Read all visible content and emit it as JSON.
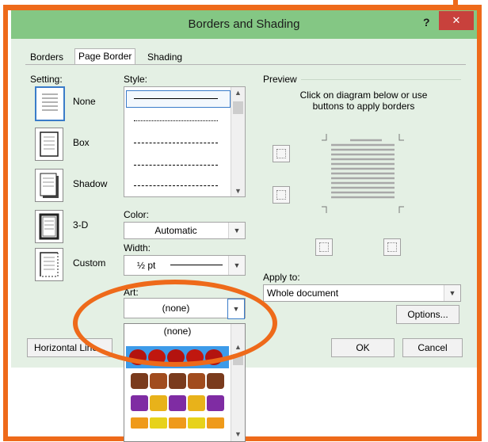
{
  "dialog": {
    "title": "Borders and Shading",
    "help": "?",
    "close": "✕",
    "tabs": [
      {
        "label": "Borders"
      },
      {
        "label": "Page Border"
      },
      {
        "label": "Shading"
      }
    ]
  },
  "setting": {
    "label": "Setting:",
    "items": [
      {
        "label": "None"
      },
      {
        "label": "Box"
      },
      {
        "label": "Shadow"
      },
      {
        "label": "3-D"
      },
      {
        "label": "Custom"
      }
    ]
  },
  "style": {
    "label": "Style:",
    "line_types": [
      "solid",
      "dotted",
      "dashed-fine",
      "dashed",
      "dash-dot"
    ]
  },
  "color": {
    "label": "Color:",
    "value": "Automatic"
  },
  "width": {
    "label": "Width:",
    "value": "½ pt"
  },
  "art": {
    "label": "Art:",
    "value": "(none)",
    "list_first": "(none)"
  },
  "preview": {
    "label": "Preview",
    "hint": "Click on diagram below or use buttons to apply borders"
  },
  "apply": {
    "label": "Apply to:",
    "value": "Whole document"
  },
  "buttons": {
    "options": "Options...",
    "horizontal_line": "Horizontal Line...",
    "ok": "OK",
    "cancel": "Cancel"
  },
  "colors": {
    "titlebar": "#84c784",
    "accent_orange": "#ee6a1a",
    "selection_blue": "#3d9be9"
  }
}
